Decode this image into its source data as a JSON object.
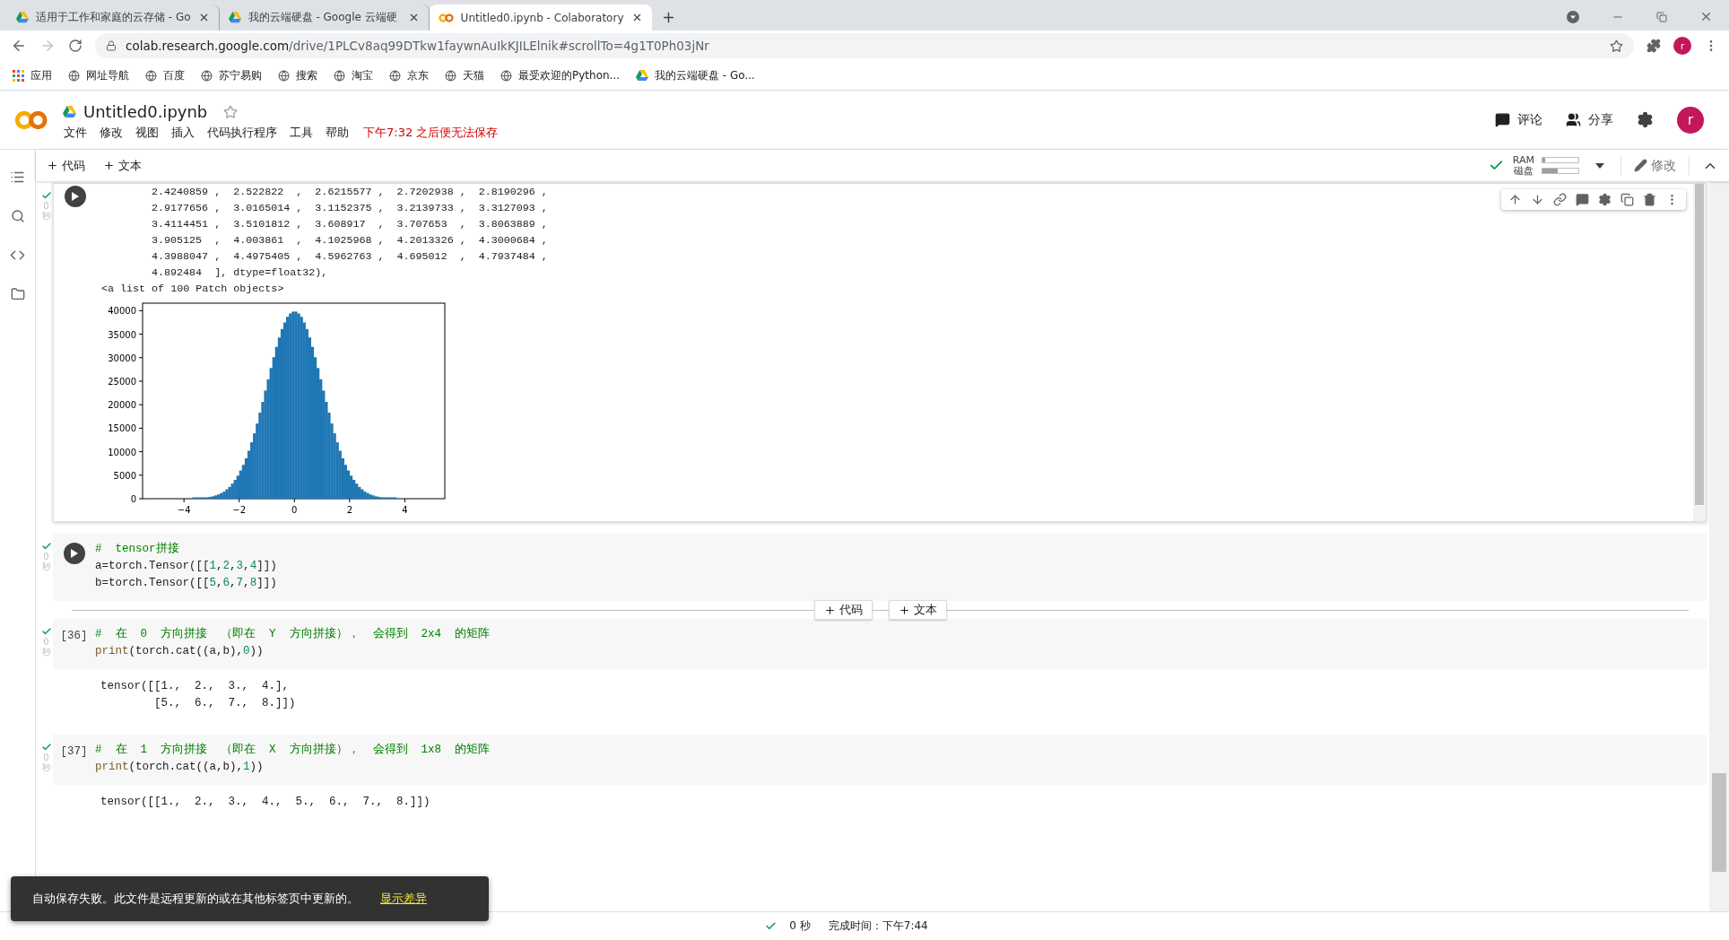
{
  "browser": {
    "tabs": [
      {
        "title": "适用于工作和家庭的云存储 - Go",
        "kind": "drive",
        "selected": false
      },
      {
        "title": "我的云端硬盘 - Google 云端硬",
        "kind": "drive",
        "selected": false
      },
      {
        "title": "Untitled0.ipynb - Colaboratory",
        "kind": "colab",
        "selected": true
      }
    ],
    "address": {
      "domain": "colab.research.google.com",
      "path": "/drive/1PLCv8aq99DTkw1faywnAuIkKJILElnik#scrollTo=4g1T0Ph03jNr"
    },
    "profile": "r",
    "bookmarks": [
      {
        "label": "应用",
        "kind": "apps"
      },
      {
        "label": "网址导航",
        "kind": "globe"
      },
      {
        "label": "百度",
        "kind": "globe"
      },
      {
        "label": "苏宁易购",
        "kind": "globe"
      },
      {
        "label": "搜索",
        "kind": "globe"
      },
      {
        "label": "淘宝",
        "kind": "globe"
      },
      {
        "label": "京东",
        "kind": "globe"
      },
      {
        "label": "天猫",
        "kind": "globe"
      },
      {
        "label": "最受欢迎的Python...",
        "kind": "globe"
      },
      {
        "label": "我的云端硬盘 - Go...",
        "kind": "drive"
      }
    ]
  },
  "header": {
    "title": "Untitled0.ipynb",
    "starred": false,
    "menu": [
      "文件",
      "修改",
      "视图",
      "插入",
      "代码执行程序",
      "工具",
      "帮助"
    ],
    "warning": "下午7:32 之后便无法保存",
    "actions": [
      {
        "label": "评论",
        "kind": "comment"
      },
      {
        "label": "分享",
        "kind": "people"
      }
    ],
    "avatar": "r"
  },
  "toolbar": {
    "add": [
      "代码",
      "文本"
    ],
    "connected": true,
    "resources": [
      {
        "label": "RAM",
        "level": 0.08
      },
      {
        "label": "磁盘",
        "level": 0.42
      }
    ],
    "edit": "修改"
  },
  "cells": [
    {
      "kind": "output",
      "done": true,
      "time": "0",
      "unit": "秒",
      "output_lines": [
        "2.4240859 ,  2.522822  ,  2.6215577 ,  2.7202938 ,  2.8190296 ,",
        "2.9177656 ,  3.0165014 ,  3.1152375 ,  3.2139733 ,  3.3127093 ,",
        "3.4114451 ,  3.5101812 ,  3.608917  ,  3.707653  ,  3.8063889 ,",
        "3.905125  ,  4.003861  ,  4.1025968 ,  4.2013326 ,  4.3000684 ,",
        "4.3988047 ,  4.4975405 ,  4.5962763 ,  4.695012  ,  4.7937484 ,",
        "4.892484  ], dtype=float32),"
      ],
      "patch_line": "<a list of 100 Patch objects>",
      "chart_data": {
        "type": "bar",
        "x": [
          -4.95,
          -4.85,
          -4.75,
          -4.65,
          -4.55,
          -4.45,
          -4.35,
          -4.25,
          -4.15,
          -4.05,
          -3.95,
          -3.85,
          -3.75,
          -3.65,
          -3.55,
          -3.45,
          -3.35,
          -3.25,
          -3.15,
          -3.05,
          -2.95,
          -2.85,
          -2.75,
          -2.65,
          -2.55,
          -2.45,
          -2.35,
          -2.25,
          -2.15,
          -2.05,
          -1.95,
          -1.85,
          -1.75,
          -1.65,
          -1.55,
          -1.45,
          -1.35,
          -1.25,
          -1.15,
          -1.05,
          -0.95,
          -0.85,
          -0.75,
          -0.65,
          -0.55,
          -0.45,
          -0.35,
          -0.25,
          -0.15,
          -0.05,
          0.05,
          0.15,
          0.25,
          0.35,
          0.45,
          0.55,
          0.65,
          0.75,
          0.85,
          0.95,
          1.05,
          1.15,
          1.25,
          1.35,
          1.45,
          1.55,
          1.65,
          1.75,
          1.85,
          1.95,
          2.05,
          2.15,
          2.25,
          2.35,
          2.45,
          2.55,
          2.65,
          2.75,
          2.85,
          2.95,
          3.05,
          3.15,
          3.25,
          3.35,
          3.45,
          3.55,
          3.65,
          3.75,
          3.85,
          3.95,
          4.05,
          4.15,
          4.25,
          4.35,
          4.45,
          4.55,
          4.65,
          4.75,
          4.85,
          4.95
        ],
        "values": [
          0,
          0,
          0,
          0,
          0,
          0,
          0,
          0,
          0,
          0,
          0,
          0,
          0,
          100,
          100,
          100,
          100,
          200,
          300,
          400,
          500,
          700,
          900,
          1200,
          1500,
          2000,
          2500,
          3200,
          4000,
          4900,
          6000,
          7200,
          8600,
          10200,
          12000,
          13900,
          16000,
          18300,
          20600,
          23000,
          25400,
          27800,
          30100,
          32300,
          34300,
          36100,
          37500,
          38700,
          39400,
          39800,
          39800,
          39400,
          38700,
          37500,
          36100,
          34300,
          32300,
          30100,
          27800,
          25400,
          23000,
          20600,
          18300,
          16000,
          13900,
          12000,
          10200,
          8600,
          7200,
          6000,
          4900,
          4000,
          3200,
          2500,
          2000,
          1500,
          1200,
          900,
          700,
          500,
          400,
          300,
          200,
          100,
          100,
          100,
          100,
          0,
          0,
          0,
          0,
          0,
          0,
          0,
          0,
          0,
          0,
          0,
          0,
          0
        ],
        "xlim": [
          -5.5,
          5.45
        ],
        "ylim": [
          0,
          41600
        ],
        "xticks": [
          -4,
          -2,
          0,
          2,
          4
        ],
        "yticks": [
          0,
          5000,
          10000,
          15000,
          20000,
          25000,
          30000,
          35000,
          40000
        ]
      }
    },
    {
      "kind": "code",
      "done": true,
      "time": "0",
      "unit": "秒",
      "lines": [
        [
          {
            "text": "#  tensor拼接",
            "kind": "comment"
          }
        ],
        [
          {
            "text": "a=torch.Tensor([[",
            "kind": "plain"
          },
          {
            "text": "1",
            "kind": "number"
          },
          {
            "text": ",",
            "kind": "plain"
          },
          {
            "text": "2",
            "kind": "number"
          },
          {
            "text": ",",
            "kind": "plain"
          },
          {
            "text": "3",
            "kind": "number"
          },
          {
            "text": ",",
            "kind": "plain"
          },
          {
            "text": "4",
            "kind": "number"
          },
          {
            "text": "]])",
            "kind": "plain"
          }
        ],
        [
          {
            "text": "b=torch.Tensor([[",
            "kind": "plain"
          },
          {
            "text": "5",
            "kind": "number"
          },
          {
            "text": ",",
            "kind": "plain"
          },
          {
            "text": "6",
            "kind": "number"
          },
          {
            "text": ",",
            "kind": "plain"
          },
          {
            "text": "7",
            "kind": "number"
          },
          {
            "text": ",",
            "kind": "plain"
          },
          {
            "text": "8",
            "kind": "number"
          },
          {
            "text": "]])",
            "kind": "plain"
          }
        ]
      ],
      "add_after": [
        "代码",
        "文本"
      ]
    },
    {
      "kind": "code",
      "done": true,
      "time": "0",
      "unit": "秒",
      "count": "[36]",
      "lines": [
        [
          {
            "text": "#  在  0  方向拼接  （即在  Y  方向拼接），  会得到  2x4  的矩阵",
            "kind": "comment"
          }
        ],
        [
          {
            "text": "print",
            "kind": "builtin"
          },
          {
            "text": "(torch.cat((a,b),",
            "kind": "plain"
          },
          {
            "text": "0",
            "kind": "number"
          },
          {
            "text": "))",
            "kind": "plain"
          }
        ]
      ],
      "output_lines": [
        "tensor([[1.,  2.,  3.,  4.],",
        "        [5.,  6.,  7.,  8.]])"
      ]
    },
    {
      "kind": "code",
      "done": true,
      "time": "0",
      "unit": "秒",
      "count": "[37]",
      "lines": [
        [
          {
            "text": "#  在  1  方向拼接  （即在  X  方向拼接），  会得到  1x8  的矩阵",
            "kind": "comment"
          }
        ],
        [
          {
            "text": "print",
            "kind": "builtin"
          },
          {
            "text": "(torch.cat((a,b),",
            "kind": "plain"
          },
          {
            "text": "1",
            "kind": "number"
          },
          {
            "text": "))",
            "kind": "plain"
          }
        ]
      ],
      "output_lines": [
        "tensor([[1.,  2.,  3.,  4.,  5.,  6.,  7.,  8.]])"
      ]
    }
  ],
  "toast": {
    "message": "自动保存失败。此文件是远程更新的或在其他标签页中更新的。",
    "action": "显示差异"
  },
  "status": {
    "done": true,
    "time": "0 秒",
    "finished": "完成时间：下午7:44"
  }
}
